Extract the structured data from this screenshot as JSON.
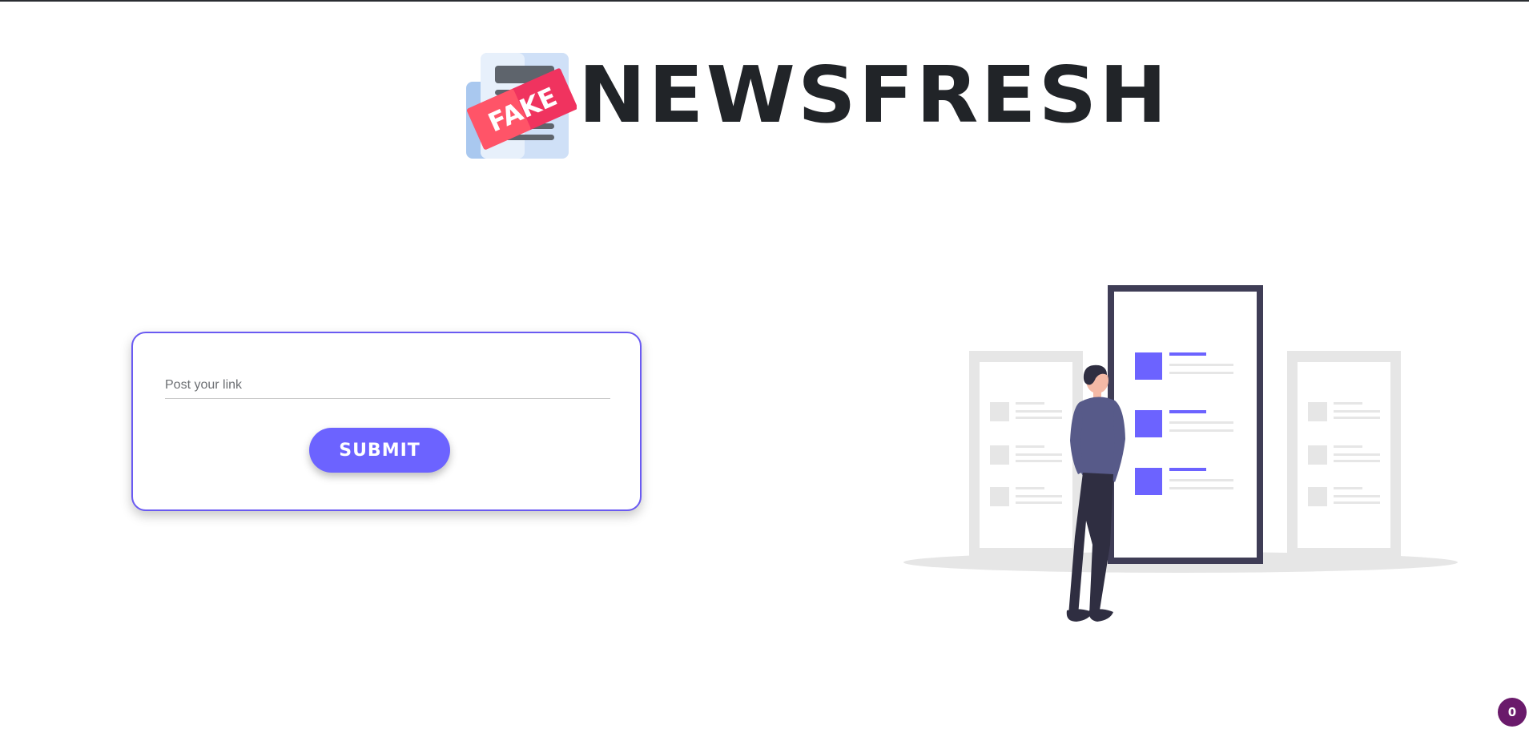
{
  "header": {
    "logo_badge_text": "FAKE",
    "brand_name": "NEWSFRESH"
  },
  "form": {
    "link_input": {
      "placeholder": "Post your link",
      "value": ""
    },
    "submit_label": "SUBMIT"
  },
  "badge": {
    "count": "0"
  },
  "colors": {
    "accent": "#6c63ff",
    "card_border": "#6a5af2",
    "brand_text": "#212428",
    "fake_label": "#e8345a",
    "badge_bg": "#6a1a6b",
    "illustration_gray": "#e6e6e6",
    "illustration_dark": "#3f3d56"
  },
  "icons": {
    "logo": "fake-newspaper-icon",
    "illustration": "person-viewing-documents-illustration"
  }
}
